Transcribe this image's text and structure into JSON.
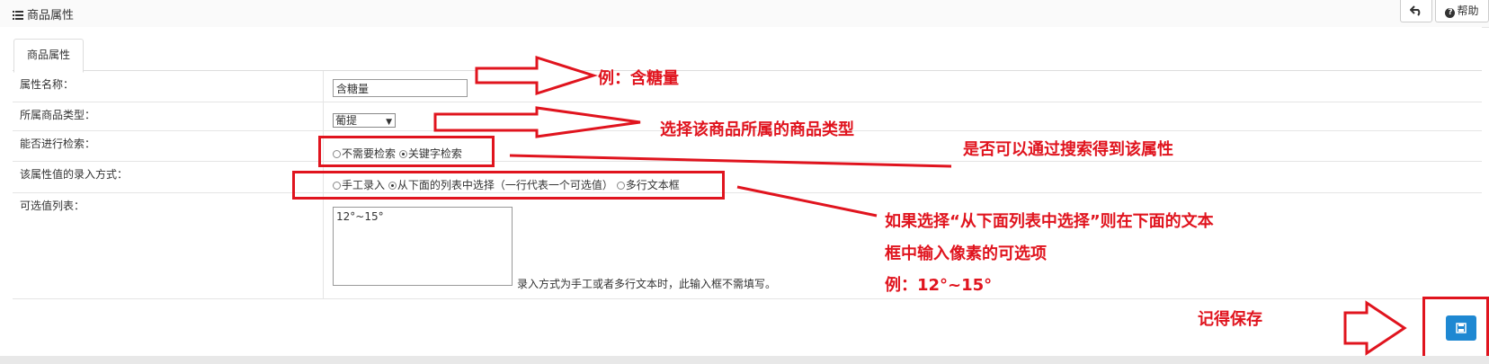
{
  "header": {
    "title": "商品属性",
    "back_icon": "undo-icon",
    "help_label": "帮助"
  },
  "tabs": [
    {
      "label": "商品属性"
    }
  ],
  "form": {
    "name": {
      "label": "属性名称：",
      "value": "含糖量"
    },
    "type": {
      "label": "所属商品类型：",
      "value": "葡提"
    },
    "search": {
      "label": "能否进行检索：",
      "options": [
        {
          "label": "不需要检索",
          "checked": false
        },
        {
          "label": "关键字检索",
          "checked": true
        }
      ]
    },
    "input_mode": {
      "label": "该属性值的录入方式：",
      "options": [
        {
          "label": "手工录入",
          "checked": false
        },
        {
          "label": "从下面的列表中选择（一行代表一个可选值）",
          "checked": true
        },
        {
          "label": "多行文本框",
          "checked": false
        }
      ]
    },
    "values": {
      "label": "可选值列表：",
      "value": "12°~15°",
      "hint": "录入方式为手工或者多行文本时，此输入框不需填写。"
    }
  },
  "annotations": {
    "example": "例：含糖量",
    "choose_type": "选择该商品所属的商品类型",
    "searchable": "是否可以通过搜索得到该属性",
    "if_select_1": "如果选择“从下面列表中选择”则在下面的文本",
    "if_select_2": "框中输入像素的可选项",
    "if_select_3": "例：12°~15°",
    "remember_save": "记得保存"
  },
  "colors": {
    "annotation_red": "#e0141e",
    "save_blue": "#1e88d2"
  }
}
